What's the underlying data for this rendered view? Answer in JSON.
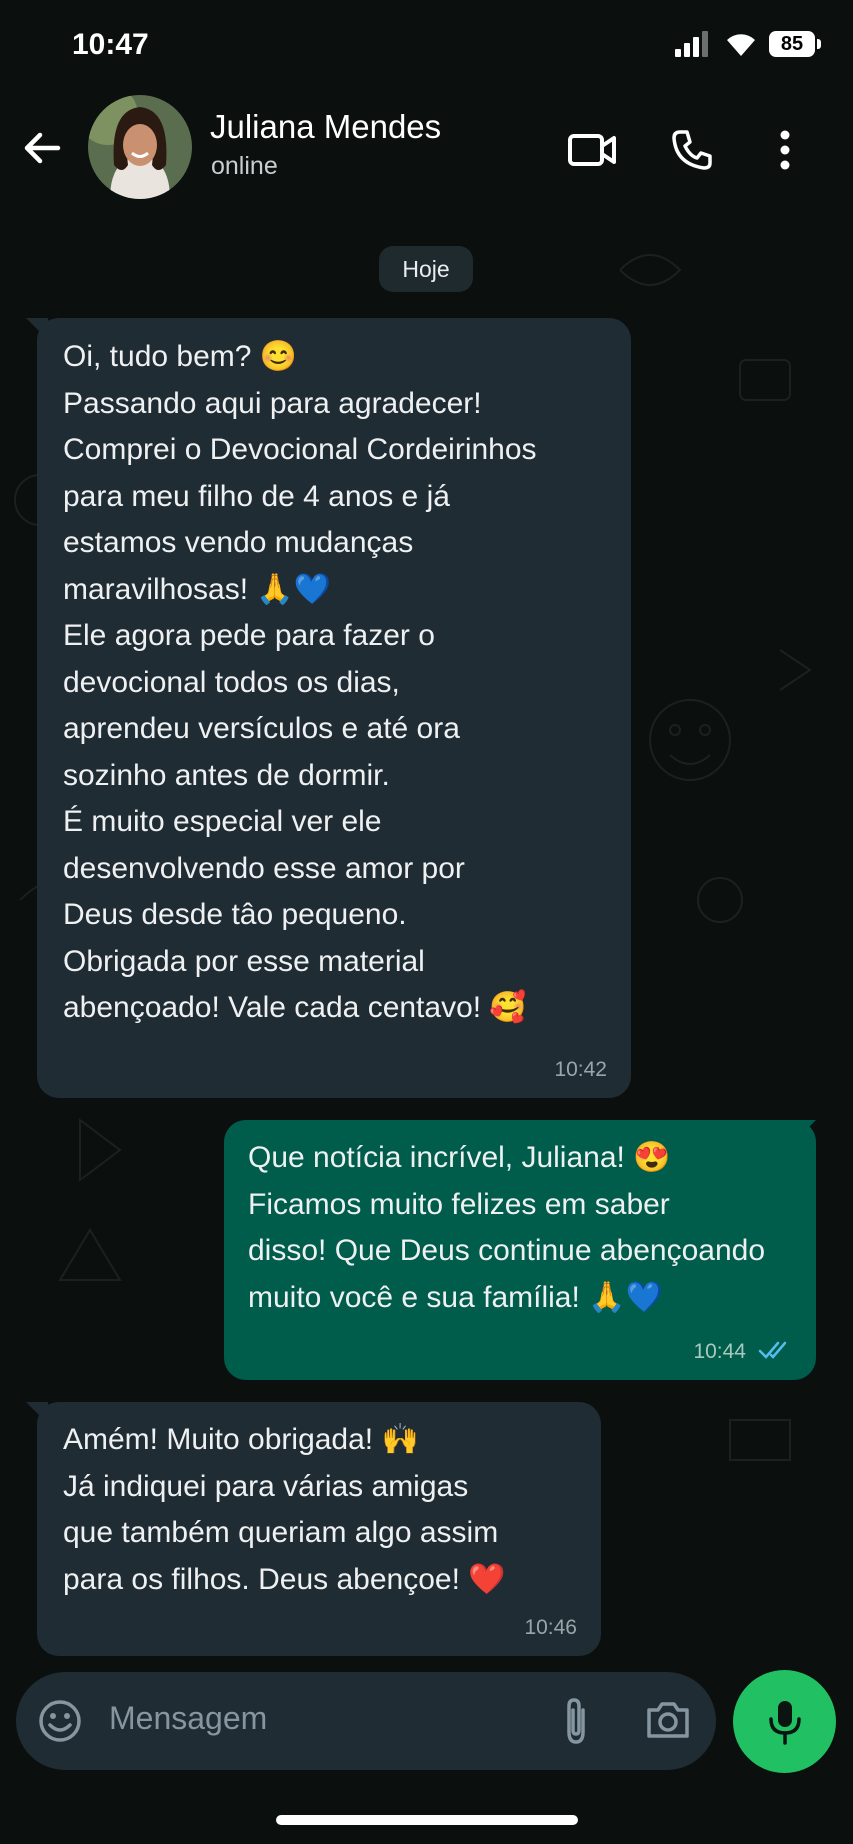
{
  "status_bar": {
    "time": "10:47",
    "battery": "85"
  },
  "contact": {
    "name": "Juliana Mendes",
    "status": "online"
  },
  "date_divider": "Hoje",
  "messages": [
    {
      "direction": "in",
      "text": "Oi, tudo bem? 😊\nPassando aqui para agradecer!\nComprei o Devocional Cordeirinhos\npara meu filho de 4 anos e já\nestamos vendo mudanças\nmaravilhosas! 🙏💙\nEle agora pede para fazer o\ndevocional todos os dias,\naprendeu versículos e até ora\nsozinho antes de dormir.\nÉ muito especial ver ele\ndesenvolvendo esse amor por\nDeus desde tâo pequeno.\nObrigada por esse material\nabençoado! Vale cada centavo! 🥰",
      "time": "10:42"
    },
    {
      "direction": "out",
      "text": "Que notícia incrível, Juliana! 😍\nFicamos muito felizes em saber\ndisso! Que Deus continue abençoando\nmuito você e sua família! 🙏💙",
      "time": "10:44",
      "read": true
    },
    {
      "direction": "in",
      "text": "Amém! Muito obrigada! 🙌\nJá indiquei para várias amigas\nque também queriam algo assim\npara os filhos. Deus abençoe! ❤️",
      "time": "10:46"
    }
  ],
  "composer": {
    "placeholder": "Mensagem"
  },
  "colors": {
    "background": "#0b0f0e",
    "incoming_bubble": "#202c33",
    "outgoing_bubble": "#005c4b",
    "accent_green": "#21c063",
    "read_ticks": "#53bdeb"
  },
  "icons": [
    "back-arrow-icon",
    "video-call-icon",
    "phone-icon",
    "more-vert-icon",
    "emoji-icon",
    "attach-icon",
    "camera-icon",
    "mic-icon",
    "signal-icon",
    "wifi-icon",
    "double-check-icon"
  ]
}
